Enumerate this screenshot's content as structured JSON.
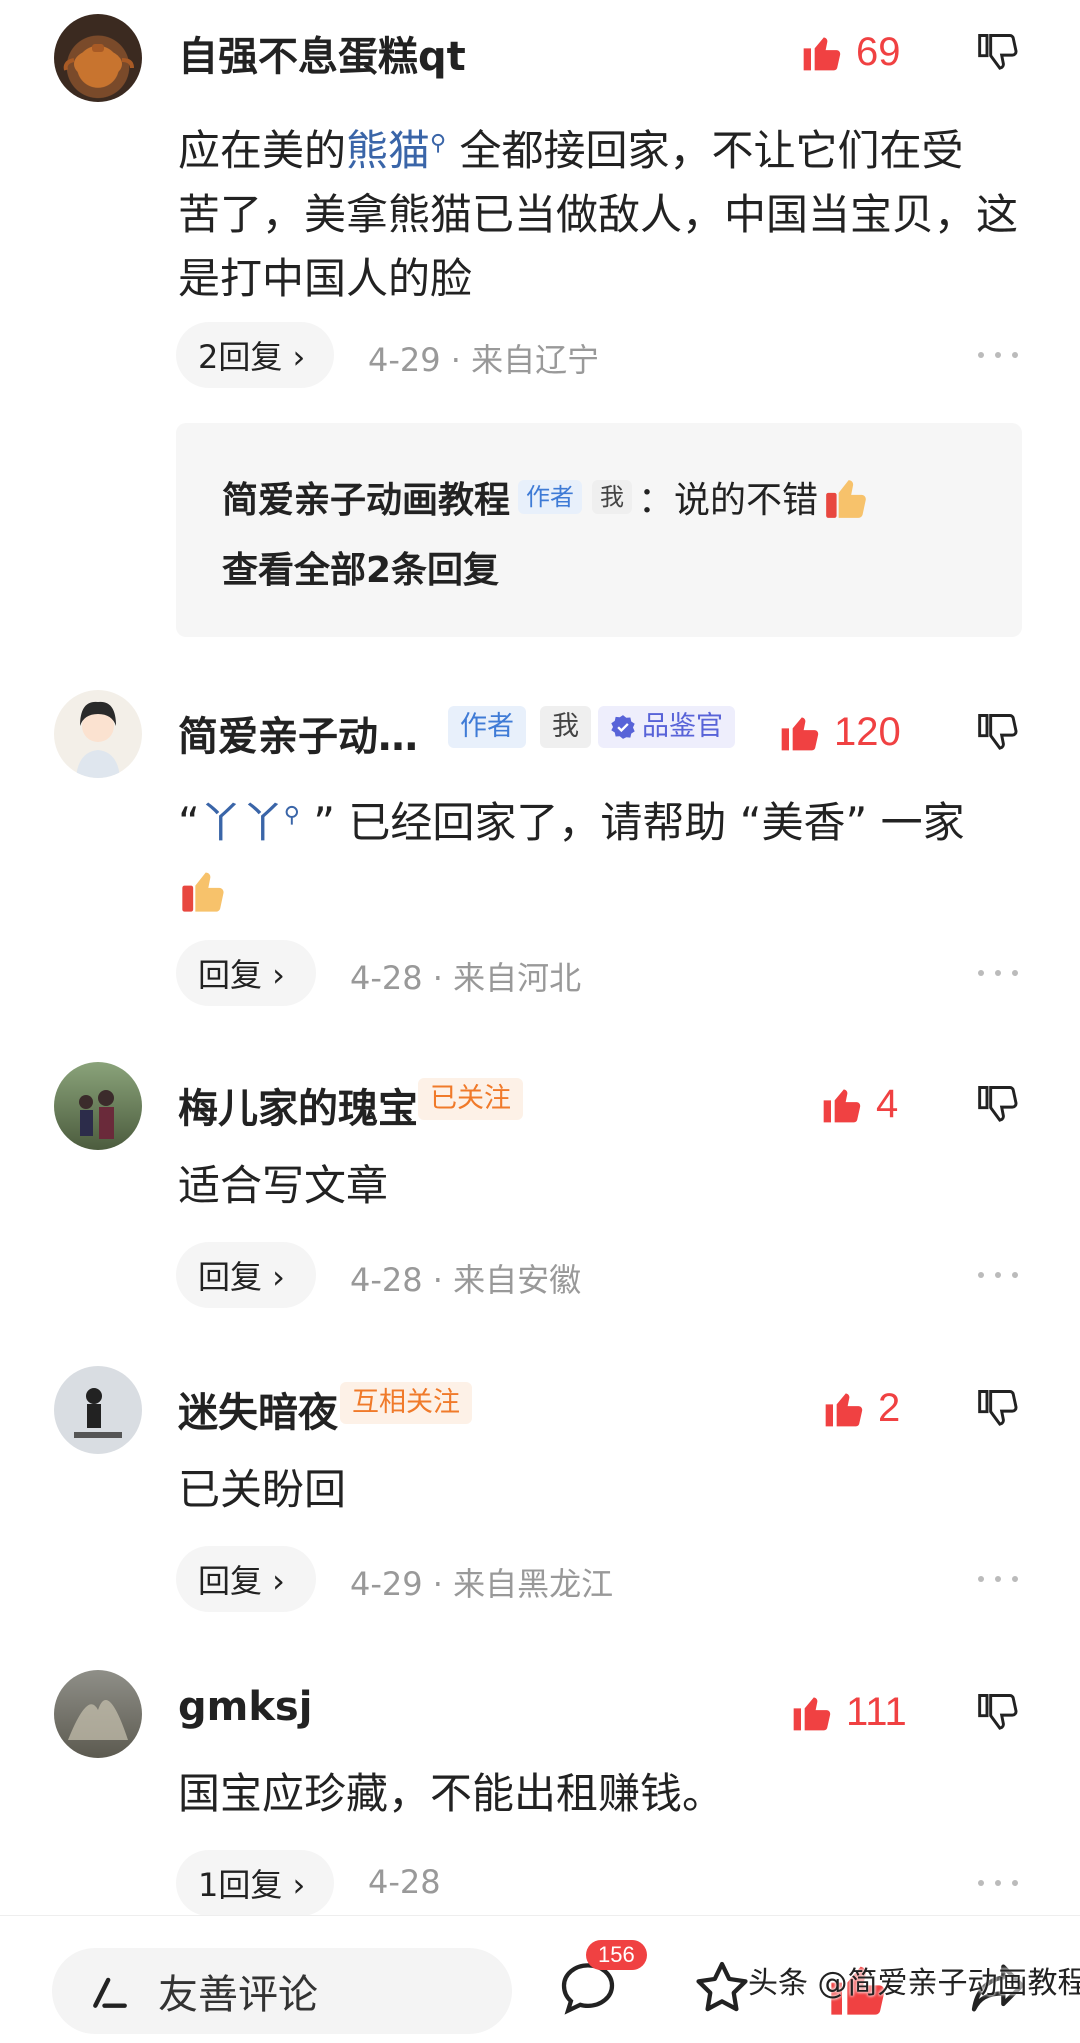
{
  "comments": [
    {
      "name": "自强不息蛋糕qt",
      "likes": "69",
      "text_before": "应在美的",
      "text_highlight": "熊猫",
      "text_line1_after": " 全都接回家，不让它们在受",
      "text_line2": "苦了，美拿熊猫已当做敌人，中国当宝贝，这",
      "text_line3": "是打中国人的脸",
      "reply_label": "2回复 ›",
      "meta": "4-29 · 来自辽宁",
      "sub_reply": {
        "author": "简爱亲子动画教程",
        "tag_author": "作者",
        "tag_me": "我",
        "text": "：说的不错",
        "view_all": "查看全部2条回复"
      }
    },
    {
      "name": "简爱亲子动…",
      "tag_author": "作者",
      "tag_me": "我",
      "tag_expert": "品鉴官",
      "likes": "120",
      "text_open_quote": "“",
      "text_highlight": "丫丫",
      "text_after": " ” 已经回家了，请帮助 “美香” 一家",
      "reply_label": "回复 ›",
      "meta": "4-28 · 来自河北"
    },
    {
      "name": "梅儿家的瑰宝",
      "tag_follow": "已关注",
      "likes": "4",
      "text": "适合写文章",
      "reply_label": "回复 ›",
      "meta": "4-28 · 来自安徽"
    },
    {
      "name": "迷失暗夜",
      "tag_follow": "互相关注",
      "likes": "2",
      "text": "已关盼回",
      "reply_label": "回复 ›",
      "meta": "4-29 · 来自黑龙江"
    },
    {
      "name": "gmksj",
      "likes": "111",
      "text": "国宝应珍藏，不能出租赚钱。",
      "reply_label": "1回复 ›",
      "meta": "4-28"
    }
  ],
  "bottom_bar": {
    "input_placeholder": "友善评论",
    "comment_count": "156"
  },
  "watermark": "头条 @简爱亲子动画教程",
  "colors": {
    "like_red": "#f04142",
    "link_blue": "#3a65a8",
    "meta_gray": "#999999"
  }
}
